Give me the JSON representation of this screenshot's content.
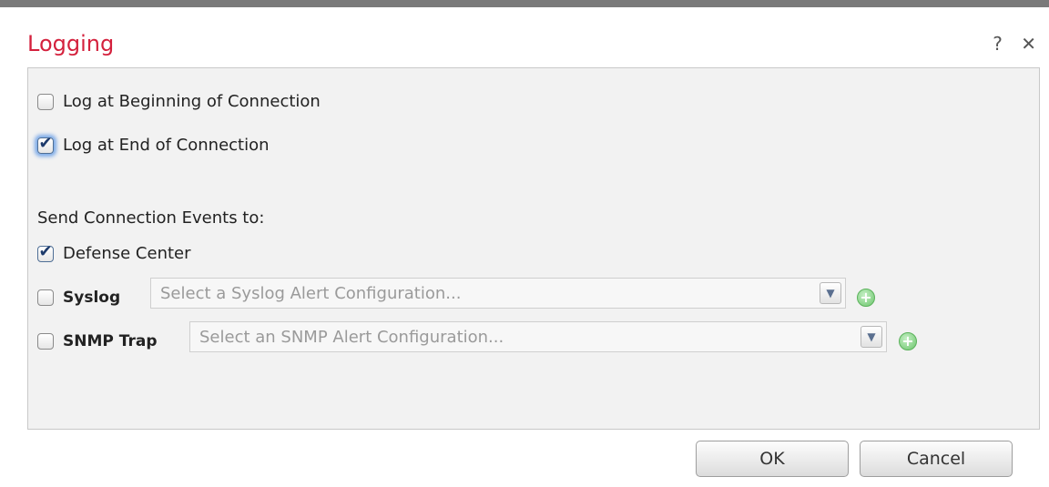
{
  "dialog": {
    "title": "Logging",
    "help_icon": "?",
    "close_icon": "✕"
  },
  "options": {
    "log_beginning": {
      "label": "Log at Beginning of Connection",
      "checked": false
    },
    "log_end": {
      "label": "Log at End of Connection",
      "checked": true
    }
  },
  "send_events": {
    "heading": "Send Connection Events to:",
    "defense_center": {
      "label": "Defense Center",
      "checked": true
    },
    "syslog": {
      "label": "Syslog",
      "checked": false,
      "placeholder": "Select a Syslog Alert Configuration..."
    },
    "snmp": {
      "label": "SNMP Trap",
      "checked": false,
      "placeholder": "Select an SNMP Alert Configuration..."
    }
  },
  "buttons": {
    "ok": "OK",
    "cancel": "Cancel"
  },
  "colors": {
    "title": "#d4213d",
    "panel_bg": "#f2f2f2",
    "add_icon": "#6cc56c",
    "focus_glow": "#7aa9e8"
  },
  "icons": {
    "help": "help-icon",
    "close": "close-icon",
    "dropdown": "chevron-down-icon",
    "add": "add-circle-icon",
    "check": "checkmark-icon"
  }
}
